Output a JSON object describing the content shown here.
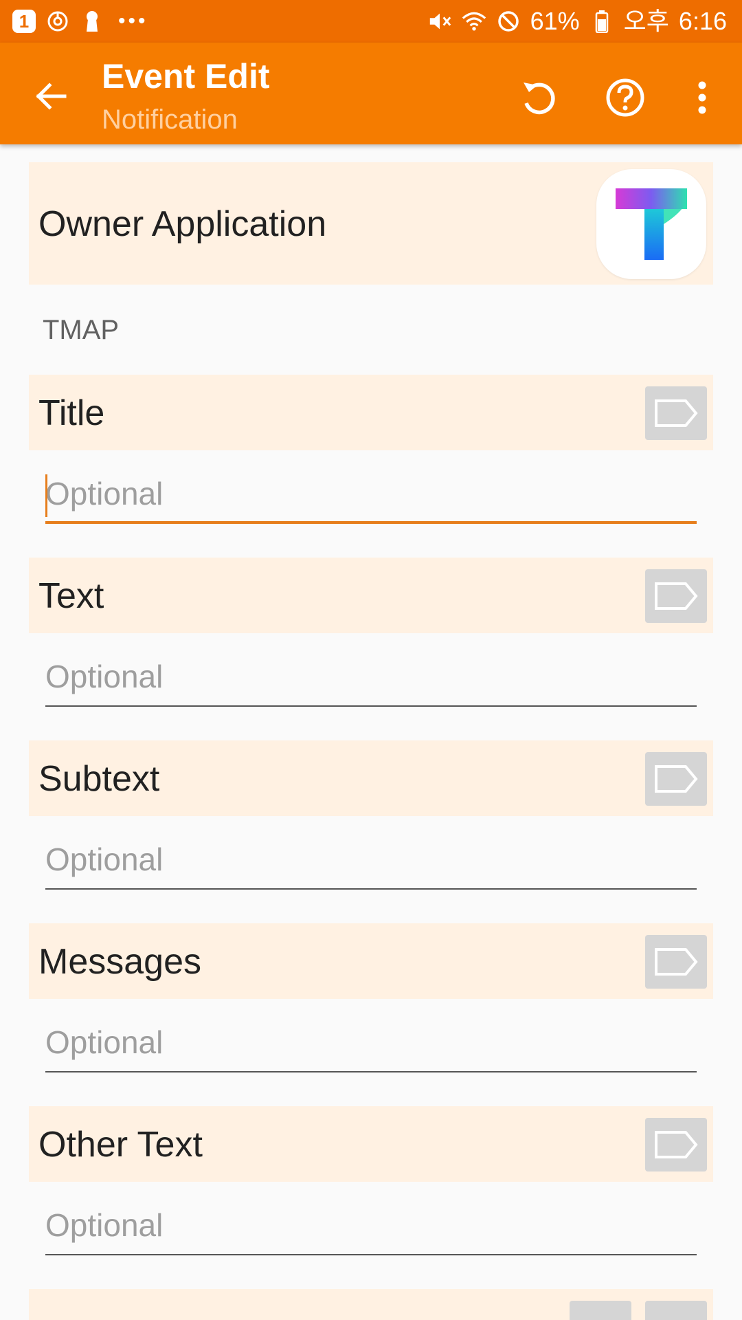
{
  "status_bar": {
    "badge": "1",
    "battery": "61%",
    "ampm": "오후",
    "time": "6:16",
    "icons": [
      "notification-badge-icon",
      "sync-icon",
      "keyhole-icon",
      "more-notifications-icon",
      "mute-vibrate-icon",
      "wifi-icon",
      "blocked-icon",
      "battery-icon"
    ]
  },
  "toolbar": {
    "title": "Event Edit",
    "subtitle": "Notification",
    "icons": [
      "back-arrow-icon",
      "undo-icon",
      "help-icon",
      "overflow-menu-icon"
    ]
  },
  "owner": {
    "label": "Owner Application",
    "app_name": "TMAP",
    "app_icon": "tmap-app-icon"
  },
  "fields": [
    {
      "label": "Title",
      "value": "",
      "placeholder": "Optional",
      "focused": true
    },
    {
      "label": "Text",
      "value": "",
      "placeholder": "Optional",
      "focused": false
    },
    {
      "label": "Subtext",
      "value": "",
      "placeholder": "Optional",
      "focused": false
    },
    {
      "label": "Messages",
      "value": "",
      "placeholder": "Optional",
      "focused": false
    },
    {
      "label": "Other Text",
      "value": "",
      "placeholder": "Optional",
      "focused": false
    }
  ],
  "colors": {
    "status_bar": "#ee6d00",
    "toolbar": "#f57c00",
    "field_header_bg": "#fff1e2",
    "focus_accent": "#e67e1c"
  }
}
